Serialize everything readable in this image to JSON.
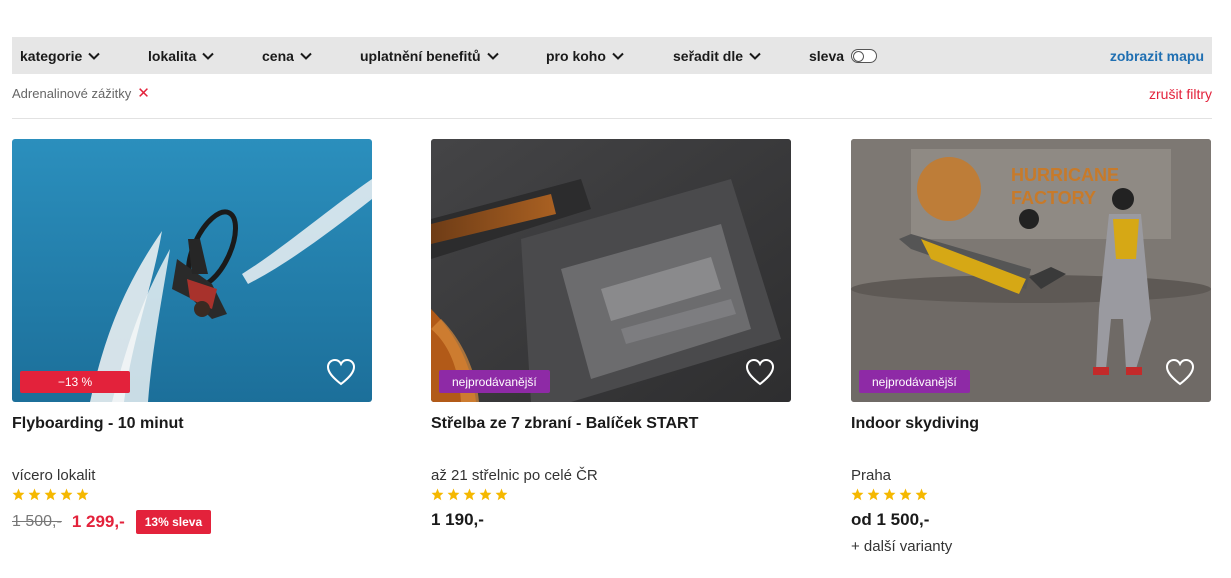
{
  "filter_bar": {
    "items": [
      {
        "label": "kategorie"
      },
      {
        "label": "lokalita"
      },
      {
        "label": "cena"
      },
      {
        "label": "uplatnění benefitů"
      },
      {
        "label": "pro koho"
      },
      {
        "label": "seřadit dle"
      }
    ],
    "discount_toggle_label": "sleva",
    "discount_toggle_on": false,
    "map_link": "zobrazit mapu"
  },
  "active_filters": {
    "chips": [
      {
        "label": "Adrenalinové zážitky",
        "remove_icon": "close-icon"
      }
    ],
    "clear_all": "zrušit filtry"
  },
  "colors": {
    "accent_red": "#e3223b",
    "bestseller_purple": "#8e2aa6",
    "link_blue": "#1f6fb2",
    "star_yellow": "#f5b800",
    "filter_bar_bg": "#e6e6e6"
  },
  "products": [
    {
      "badge": "−13 %",
      "title": "Flyboarding - 10 minut",
      "location": "vícero lokalit",
      "rating_stars": 5,
      "old_price": "1 500,-",
      "price": "1 299,-",
      "sale_badge": "13% sleva",
      "favorite_icon": "heart-icon"
    },
    {
      "badge": "nejprodávanější",
      "title": "Střelba ze 7 zbraní - Balíček START",
      "location": "až 21 střelnic po celé ČR",
      "rating_stars": 5,
      "price": "1 190,-",
      "favorite_icon": "heart-icon"
    },
    {
      "badge": "nejprodávanější",
      "title": "Indoor skydiving",
      "location": "Praha",
      "rating_stars": 5,
      "price": "od 1 500,-",
      "more_variants": "+ další varianty",
      "favorite_icon": "heart-icon",
      "image_sign_text": "HURRICANE FACTORY"
    }
  ]
}
